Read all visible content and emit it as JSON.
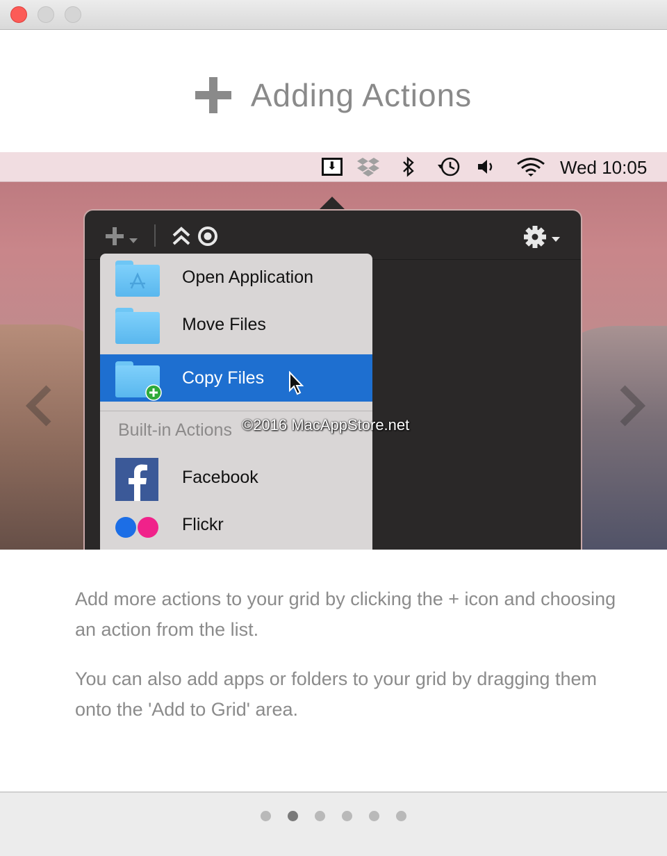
{
  "window": {
    "controls": [
      "close",
      "minimize",
      "zoom"
    ]
  },
  "header": {
    "icon": "plus-icon",
    "title": "Adding Actions"
  },
  "screenshot": {
    "menubar": {
      "icons": [
        "download-box-icon",
        "dropbox-icon",
        "bluetooth-icon",
        "time-machine-icon",
        "volume-icon",
        "wifi-icon"
      ],
      "clock": "Wed 10:05"
    },
    "toolbar": {
      "icons": [
        "plus-icon",
        "chevron-down-icon",
        "double-chevron-up-icon",
        "record-icon",
        "gear-icon"
      ]
    },
    "menu": {
      "items": [
        {
          "label": "Open Application",
          "icon": "app-folder-icon",
          "selected": false
        },
        {
          "label": "Move Files",
          "icon": "folder-icon",
          "selected": false
        },
        {
          "label": "Copy Files",
          "icon": "folder-plus-icon",
          "selected": true
        }
      ],
      "section_title": "Built-in Actions",
      "builtin": [
        {
          "label": "Facebook",
          "icon": "facebook-icon"
        },
        {
          "label": "Flickr",
          "icon": "flickr-icon"
        }
      ]
    },
    "watermark": "©2016 MacAppStore.net"
  },
  "description": {
    "p1": "Add more actions to your grid by clicking the + icon and choosing an action from the list.",
    "p2": "You can also add apps or folders to your grid by dragging them onto the 'Add to Grid' area."
  },
  "pagination": {
    "total": 6,
    "current": 2
  },
  "colors": {
    "selection": "#1e6fd0",
    "close_button": "#fc5b57",
    "heading_text": "#8a8a8a",
    "body_text": "#8b8b8b"
  }
}
